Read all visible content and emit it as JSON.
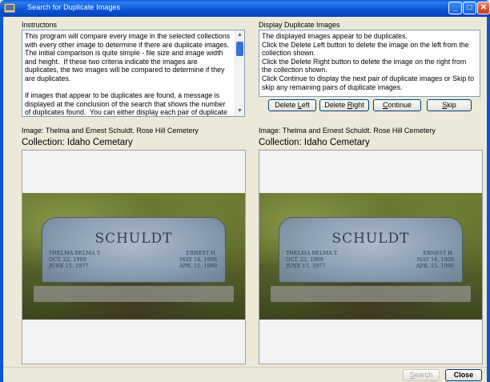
{
  "window": {
    "title": "Search for Duplicate Images"
  },
  "instructions": {
    "label": "Instructons",
    "text": "This program will compare every image in the selected collections with every other image to determine if there are duplicate images.  The initial comparison is quite simple - file size and image width and height.  If these two criteria indicate the images are duplicates, the two images will be compared to determine if they are duplicates.\n\nIf images that appear to be duplicates are found, a message is displayed at the conclusion of the search that shows the number of duplicates found.  You can either display each pair of duplicate"
  },
  "display": {
    "label": "Display Duplicate Images",
    "text": "The displayed images appear to be duplicates.\nClick the Delete Left button to delete the image on the left from the collection shown.\nClick the Delete Right button to delete the image on the right from the collection shown.\nClick Continue to display the next pair of duplicate images or Skip to skip any remaining pairs of duplicate images."
  },
  "buttons": {
    "delete_left": {
      "pre": "Delete ",
      "key": "L",
      "post": "eft"
    },
    "delete_right": {
      "pre": "Delete ",
      "key": "R",
      "post": "ight"
    },
    "continue": {
      "pre": "",
      "key": "C",
      "post": "ontinue"
    },
    "skip": {
      "pre": "",
      "key": "S",
      "post": "kip"
    },
    "search": {
      "pre": "",
      "key": "S",
      "post": "earch"
    },
    "close": "Close"
  },
  "left_image": {
    "caption": "Image: Thelma and Ernest Schuldt.  Rose Hill Cemetery",
    "collection": "Collection: Idaho Cemetary",
    "stone_name": "SCHULDT",
    "stone_left": "THELMA BELMA T.\nOCT. 22, 1909\nJUNE 15, 1977",
    "stone_right": "ERNEST H.\nMAY 16, 1908\nAPR. 15, 1990"
  },
  "right_image": {
    "caption": "Image: Thelma and Ernest Schuldt.  Rose Hill Cemetery",
    "collection": "Collection: Idaho Cemetary",
    "stone_name": "SCHULDT",
    "stone_left": "THELMA BELMA T.\nOCT. 22, 1909\nJUNE 15, 1977",
    "stone_right": "ERNEST H.\nMAY 16, 1908\nAPR. 15, 1990"
  },
  "colors": {
    "titlebar": "#0b57d6",
    "dialog_bg": "#ece9d8",
    "button_border": "#003c74"
  }
}
